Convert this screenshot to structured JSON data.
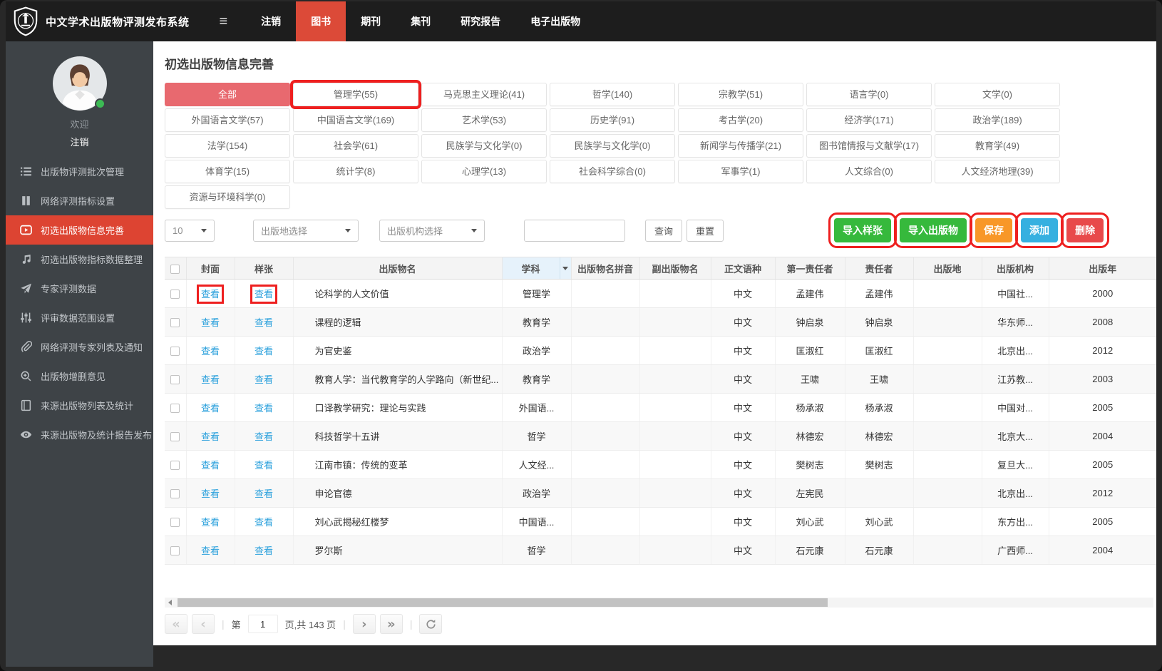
{
  "colors": {
    "navbar_bg": "#1d1d1d",
    "active_red": "#dc4a38",
    "sidebar_bg": "#3e4347",
    "sidebar_active": "#dd4432",
    "category_selected_bg": "#e8696f",
    "annotation_red": "#ee1f1f",
    "link_blue": "#2aa0dc",
    "table_subject_header_bg": "#e6f2fb"
  },
  "navbar": {
    "title": "中文学术出版物评测发布系统",
    "menu": [
      {
        "key": "logout",
        "label": "注销",
        "active": false
      },
      {
        "key": "books",
        "label": "图书",
        "active": true
      },
      {
        "key": "journals",
        "label": "期刊",
        "active": false
      },
      {
        "key": "collections",
        "label": "集刊",
        "active": false
      },
      {
        "key": "reports",
        "label": "研究报告",
        "active": false
      },
      {
        "key": "epub",
        "label": "电子出版物",
        "active": false
      }
    ]
  },
  "sidebar": {
    "welcome": "欢迎",
    "logout": "注销",
    "items": [
      {
        "key": "batch-management",
        "icon": "list-icon",
        "label": "出版物评测批次管理",
        "active": false
      },
      {
        "key": "network-index-settings",
        "icon": "pause-bars-icon",
        "label": "网络评测指标设置",
        "active": false
      },
      {
        "key": "preselect-info",
        "icon": "play-video-icon",
        "label": "初选出版物信息完善",
        "active": true
      },
      {
        "key": "preselect-index-data",
        "icon": "music-note-icon",
        "label": "初选出版物指标数据整理",
        "active": false
      },
      {
        "key": "expert-eval-data",
        "icon": "paper-plane-icon",
        "label": "专家评测数据",
        "active": false
      },
      {
        "key": "review-data-range",
        "icon": "sliders-icon",
        "label": "评审数据范围设置",
        "active": false
      },
      {
        "key": "expert-list-notice",
        "icon": "paperclip-icon",
        "label": "网络评测专家列表及通知",
        "active": false
      },
      {
        "key": "pub-add-delete-opinions",
        "icon": "search-plus-icon",
        "label": "出版物增删意见",
        "active": false
      },
      {
        "key": "source-pub-list-stats",
        "icon": "book-icon",
        "label": "来源出版物列表及统计",
        "active": false
      },
      {
        "key": "source-pub-report-publish",
        "icon": "eye-icon",
        "label": "来源出版物及统计报告发布",
        "active": false
      }
    ]
  },
  "page": {
    "title": "初选出版物信息完善"
  },
  "categories": [
    {
      "label": "全部",
      "selected": true
    },
    {
      "label": "管理学(55)",
      "annotated": true
    },
    {
      "label": "马克思主义理论(41)"
    },
    {
      "label": "哲学(140)"
    },
    {
      "label": "宗教学(51)"
    },
    {
      "label": "语言学(0)"
    },
    {
      "label": "文学(0)"
    },
    {
      "label": "外国语言文学(57)"
    },
    {
      "label": "中国语言文学(169)"
    },
    {
      "label": "艺术学(53)"
    },
    {
      "label": "历史学(91)"
    },
    {
      "label": "考古学(20)"
    },
    {
      "label": "经济学(171)"
    },
    {
      "label": "政治学(189)"
    },
    {
      "label": "法学(154)"
    },
    {
      "label": "社会学(61)"
    },
    {
      "label": "民族学与文化学(0)"
    },
    {
      "label": "民族学与文化学(0)"
    },
    {
      "label": "新闻学与传播学(21)"
    },
    {
      "label": "图书馆情报与文献学(17)"
    },
    {
      "label": "教育学(49)"
    },
    {
      "label": "体育学(15)"
    },
    {
      "label": "统计学(8)"
    },
    {
      "label": "心理学(13)"
    },
    {
      "label": "社会科学综合(0)"
    },
    {
      "label": "军事学(1)"
    },
    {
      "label": "人文综合(0)"
    },
    {
      "label": "人文经济地理(39)"
    },
    {
      "label": "资源与环境科学(0)"
    }
  ],
  "filters": {
    "page_size": "10",
    "place_placeholder": "出版地选择",
    "org_placeholder": "出版机构选择",
    "search_value": "",
    "query_label": "查询",
    "reset_label": "重置"
  },
  "actions": [
    {
      "key": "import-sample",
      "label": "导入样张",
      "color": "#36b93c",
      "annotated": true
    },
    {
      "key": "import-publication",
      "label": "导入出版物",
      "color": "#36b93c",
      "annotated": true
    },
    {
      "key": "save",
      "label": "保存",
      "color": "#f89728",
      "annotated": true
    },
    {
      "key": "add",
      "label": "添加",
      "color": "#36b0e0",
      "annotated": true
    },
    {
      "key": "delete",
      "label": "删除",
      "color": "#e8494b",
      "annotated": true
    }
  ],
  "table": {
    "view_label": "查看",
    "columns": [
      "封面",
      "样张",
      "出版物名",
      "学科",
      "出版物名拼音",
      "副出版物名",
      "正文语种",
      "第一责任者",
      "责任者",
      "出版地",
      "出版机构",
      "出版年"
    ],
    "rows": [
      {
        "title": "论科学的人文价值",
        "subject": "管理学",
        "pinyin": "",
        "subtitle": "",
        "language": "中文",
        "first_author": "孟建伟",
        "author": "孟建伟",
        "place": "",
        "publisher": "中国社...",
        "year": "2000",
        "annotated": true
      },
      {
        "title": "课程的逻辑",
        "subject": "教育学",
        "pinyin": "",
        "subtitle": "",
        "language": "中文",
        "first_author": "钟启泉",
        "author": "钟启泉",
        "place": "",
        "publisher": "华东师...",
        "year": "2008"
      },
      {
        "title": "为官史鉴",
        "subject": "政治学",
        "pinyin": "",
        "subtitle": "",
        "language": "中文",
        "first_author": "匡淑红",
        "author": "匡淑红",
        "place": "",
        "publisher": "北京出...",
        "year": "2012"
      },
      {
        "title": "教育人学：当代教育学的人学路向（新世纪...",
        "subject": "教育学",
        "pinyin": "",
        "subtitle": "",
        "language": "中文",
        "first_author": "王啸",
        "author": "王啸",
        "place": "",
        "publisher": "江苏教...",
        "year": "2003"
      },
      {
        "title": "口译教学研究：理论与实践",
        "subject": "外国语...",
        "pinyin": "",
        "subtitle": "",
        "language": "中文",
        "first_author": "杨承淑",
        "author": "杨承淑",
        "place": "",
        "publisher": "中国对...",
        "year": "2005"
      },
      {
        "title": "科技哲学十五讲",
        "subject": "哲学",
        "pinyin": "",
        "subtitle": "",
        "language": "中文",
        "first_author": "林德宏",
        "author": "林德宏",
        "place": "",
        "publisher": "北京大...",
        "year": "2004"
      },
      {
        "title": "江南市镇：传统的变革",
        "subject": "人文经...",
        "pinyin": "",
        "subtitle": "",
        "language": "中文",
        "first_author": "樊树志",
        "author": "樊树志",
        "place": "",
        "publisher": "复旦大...",
        "year": "2005"
      },
      {
        "title": "申论官德",
        "subject": "政治学",
        "pinyin": "",
        "subtitle": "",
        "language": "中文",
        "first_author": "左宪民",
        "author": "",
        "place": "",
        "publisher": "北京出...",
        "year": "2012"
      },
      {
        "title": "刘心武揭秘红楼梦",
        "subject": "中国语...",
        "pinyin": "",
        "subtitle": "",
        "language": "中文",
        "first_author": "刘心武",
        "author": "刘心武",
        "place": "",
        "publisher": "东方出...",
        "year": "2005"
      },
      {
        "title": "罗尔斯",
        "subject": "哲学",
        "pinyin": "",
        "subtitle": "",
        "language": "中文",
        "first_author": "石元康",
        "author": "石元康",
        "place": "",
        "publisher": "广西师...",
        "year": "2004"
      }
    ]
  },
  "pagination": {
    "page_prefix": "第",
    "current_page": "1",
    "page_suffix": "页,共 143 页"
  }
}
